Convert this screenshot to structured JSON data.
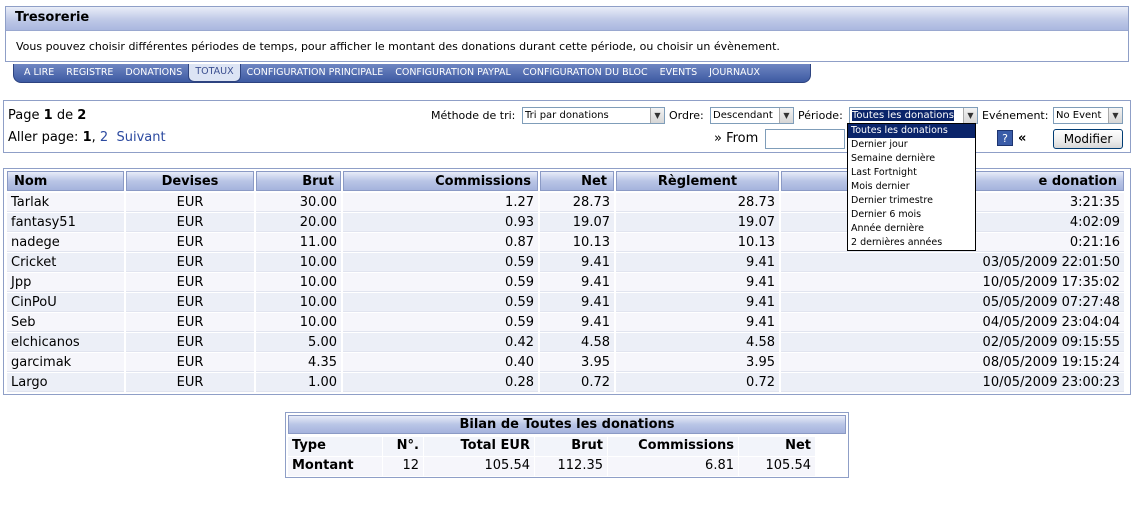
{
  "header": {
    "title": "Tresorerie",
    "description": "Vous pouvez choisir différentes périodes de temps, pour afficher le montant des donations durant cette période, ou choisir un évènement."
  },
  "tabs": [
    "A LIRE",
    "REGISTRE",
    "DONATIONS",
    "TOTAUX",
    "CONFIGURATION PRINCIPALE",
    "CONFIGURATION PAYPAL",
    "CONFIGURATION DU BLOC",
    "EVENTS",
    "JOURNAUX"
  ],
  "active_tab": "TOTAUX",
  "pagination": {
    "page_prefix": "Page",
    "current": "1",
    "of": "de",
    "total": "2",
    "goto_label": "Aller page:",
    "page1": "1",
    "sep": ",",
    "page2": "2",
    "next": "Suivant"
  },
  "filters": {
    "sort_label": "Méthode de tri:",
    "sort_value": "Tri par donations",
    "order_label": "Ordre:",
    "order_value": "Descendant",
    "period_label": "Période:",
    "period_value": "Toutes les donations",
    "event_label": "Evénement:",
    "event_value": "No Event",
    "from_label": "» From",
    "from_value": "",
    "laquo": "«",
    "submit": "Modifier"
  },
  "period_options": [
    "Toutes les donations",
    "Dernier jour",
    "Semaine dernière",
    "Last Fortnight",
    "Mois dernier",
    "Dernier trimestre",
    "Dernier 6 mois",
    "Année dernière",
    "2 dernières années"
  ],
  "table": {
    "headers": [
      "Nom",
      "Devises",
      "Brut",
      "Commissions",
      "Net",
      "Règlement",
      "e donation"
    ],
    "rows": [
      [
        "Tarlak",
        "EUR",
        "30.00",
        "1.27",
        "28.73",
        "28.73",
        "3:21:35"
      ],
      [
        "fantasy51",
        "EUR",
        "20.00",
        "0.93",
        "19.07",
        "19.07",
        "4:02:09"
      ],
      [
        "nadege",
        "EUR",
        "11.00",
        "0.87",
        "10.13",
        "10.13",
        "0:21:16"
      ],
      [
        "Cricket",
        "EUR",
        "10.00",
        "0.59",
        "9.41",
        "9.41",
        "03/05/2009 22:01:50"
      ],
      [
        "Jpp",
        "EUR",
        "10.00",
        "0.59",
        "9.41",
        "9.41",
        "10/05/2009 17:35:02"
      ],
      [
        "CinPoU",
        "EUR",
        "10.00",
        "0.59",
        "9.41",
        "9.41",
        "05/05/2009 07:27:48"
      ],
      [
        "Seb",
        "EUR",
        "10.00",
        "0.59",
        "9.41",
        "9.41",
        "04/05/2009 23:04:04"
      ],
      [
        "elchicanos",
        "EUR",
        "5.00",
        "0.42",
        "4.58",
        "4.58",
        "02/05/2009 09:15:55"
      ],
      [
        "garcimak",
        "EUR",
        "4.35",
        "0.40",
        "3.95",
        "3.95",
        "08/05/2009 19:15:24"
      ],
      [
        "Largo",
        "EUR",
        "1.00",
        "0.28",
        "0.72",
        "0.72",
        "10/05/2009 23:00:23"
      ]
    ]
  },
  "summary": {
    "title": "Bilan de Toutes les donations",
    "headers": [
      "Type",
      "N°.",
      "Total EUR",
      "Brut",
      "Commissions",
      "Net"
    ],
    "values": [
      "Montant",
      "12",
      "105.54",
      "112.35",
      "6.81",
      "105.54"
    ]
  }
}
